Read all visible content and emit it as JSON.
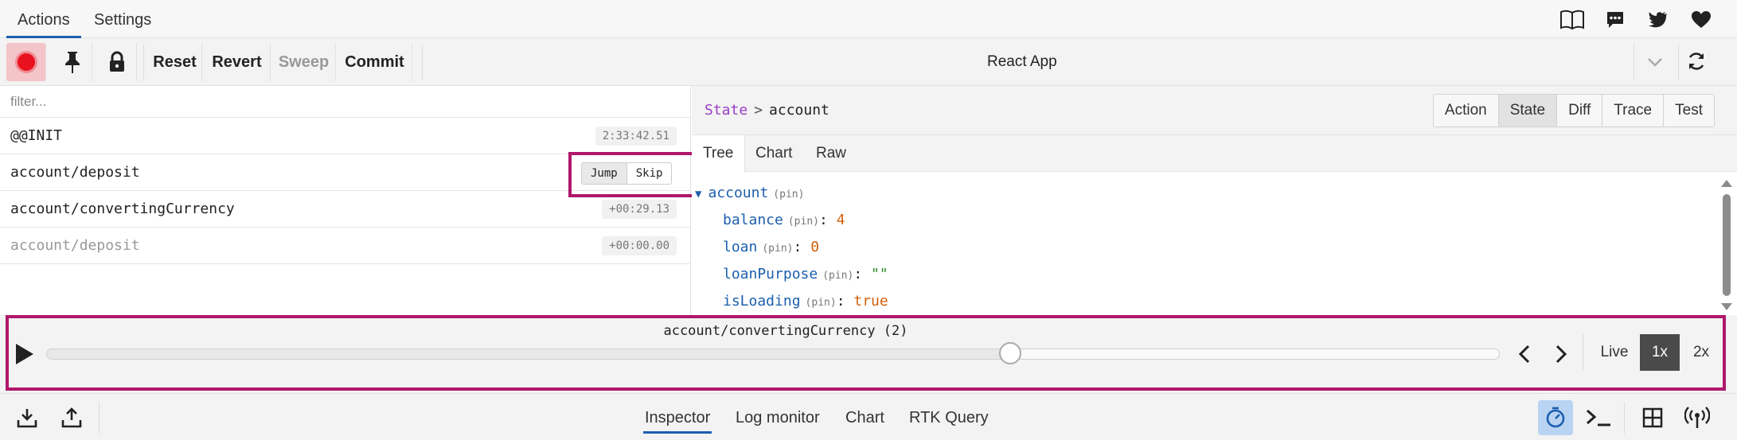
{
  "top_tabs": [
    {
      "label": "Actions",
      "active": true
    },
    {
      "label": "Settings",
      "active": false
    }
  ],
  "top_icons": [
    "book-icon",
    "chat-icon",
    "twitter-icon",
    "heart-icon"
  ],
  "toolbar": {
    "reset_label": "Reset",
    "revert_label": "Revert",
    "sweep_label": "Sweep",
    "commit_label": "Commit",
    "app_title": "React App"
  },
  "filter": {
    "placeholder": "filter..."
  },
  "actions": [
    {
      "name": "@@INIT",
      "time": "2:33:42.51",
      "skipped": false
    },
    {
      "name": "account/deposit",
      "time": "",
      "skipped": false,
      "jump_label": "Jump",
      "skip_label": "Skip"
    },
    {
      "name": "account/convertingCurrency",
      "time": "+00:29.13",
      "skipped": false
    },
    {
      "name": "account/deposit",
      "time": "+00:00.00",
      "skipped": true
    }
  ],
  "inspector": {
    "breadcrumb_root": "State",
    "breadcrumb_sep": ">",
    "breadcrumb_leaf": "account",
    "view_tabs": [
      "Action",
      "State",
      "Diff",
      "Trace",
      "Test"
    ],
    "active_view": "State",
    "sub_tabs": [
      "Tree",
      "Chart",
      "Raw"
    ],
    "active_sub_tab": "Tree"
  },
  "state_tree": {
    "root_key": "account",
    "pin_label": "(pin)",
    "fields": [
      {
        "key": "balance",
        "value": "4",
        "type": "num"
      },
      {
        "key": "loan",
        "value": "0",
        "type": "num"
      },
      {
        "key": "loanPurpose",
        "value": "\"\"",
        "type": "str"
      },
      {
        "key": "isLoading",
        "value": "true",
        "type": "bool"
      }
    ]
  },
  "slider": {
    "current_action": "account/convertingCurrency (2)",
    "position_fraction": 0.663,
    "live_label": "Live",
    "speed_1x": "1x",
    "speed_2x": "2x",
    "active_speed": "1x"
  },
  "bottom_tabs": [
    {
      "label": "Inspector",
      "active": true
    },
    {
      "label": "Log monitor",
      "active": false
    },
    {
      "label": "Chart",
      "active": false
    },
    {
      "label": "RTK Query",
      "active": false
    }
  ],
  "colors": {
    "accent": "#1c5fae",
    "highlight": "#b0176b",
    "record": "#e8121f"
  }
}
